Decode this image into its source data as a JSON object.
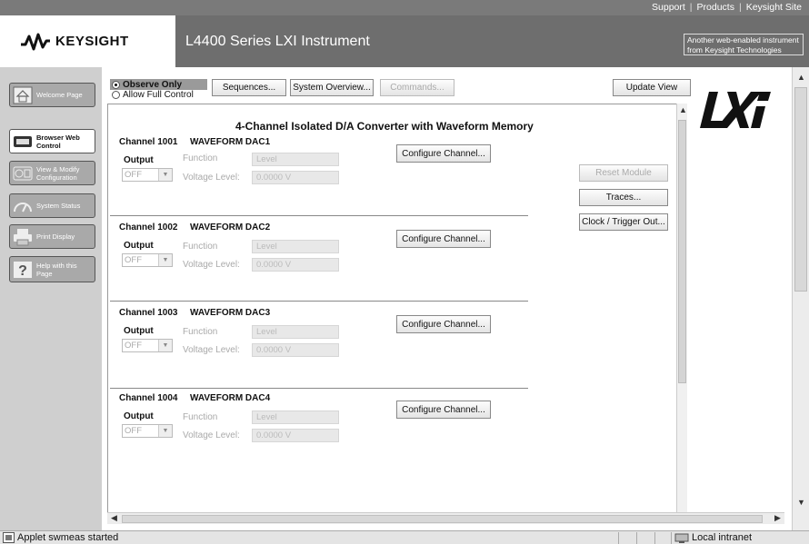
{
  "top_links": {
    "support": "Support",
    "products": "Products",
    "site": "Keysight Site",
    "sep": "|"
  },
  "logo": {
    "text": "KEYSIGHT"
  },
  "header": {
    "title": "L4400 Series LXI Instrument",
    "web_instrument": "Another web-enabled instrument from Keysight Technologies"
  },
  "sidebar": {
    "items": [
      {
        "label": "Welcome Page",
        "icon": "home-icon"
      },
      {
        "label": "Browser Web Control",
        "icon": "keyboard-icon"
      },
      {
        "label": "View & Modify Configuration",
        "icon": "config-icon"
      },
      {
        "label": "System Status",
        "icon": "status-icon"
      },
      {
        "label": "Print Display",
        "icon": "printer-icon"
      },
      {
        "label": "Help with this Page",
        "icon": "help-icon"
      }
    ]
  },
  "controls": {
    "observe_only": "Observe Only",
    "allow_full_control": "Allow Full Control",
    "sequences": "Sequences...",
    "system_overview": "System Overview...",
    "commands": "Commands...",
    "update_view": "Update View"
  },
  "panel": {
    "title": "4-Channel Isolated D/A Converter with Waveform Memory",
    "configure_label": "Configure Channel...",
    "output_label": "Output",
    "function_label": "Function",
    "voltage_label": "Voltage Level:",
    "channels": [
      {
        "id": "Channel 1001",
        "name": "WAVEFORM DAC1",
        "output": "OFF",
        "function": "Level",
        "voltage": "0.0000 V"
      },
      {
        "id": "Channel 1002",
        "name": "WAVEFORM DAC2",
        "output": "OFF",
        "function": "Level",
        "voltage": "0.0000 V"
      },
      {
        "id": "Channel 1003",
        "name": "WAVEFORM DAC3",
        "output": "OFF",
        "function": "Level",
        "voltage": "0.0000 V"
      },
      {
        "id": "Channel 1004",
        "name": "WAVEFORM DAC4",
        "output": "OFF",
        "function": "Level",
        "voltage": "0.0000 V"
      }
    ],
    "reset_module": "Reset Module",
    "traces": "Traces...",
    "clock_trigger": "Clock / Trigger Out..."
  },
  "status_bar": {
    "left": "Applet swmeas started",
    "right": "Local intranet"
  },
  "colors": {
    "topbar": "#7a7a7a",
    "title_bar": "#6e6e6e",
    "sidebar": "#cfcfcf"
  }
}
